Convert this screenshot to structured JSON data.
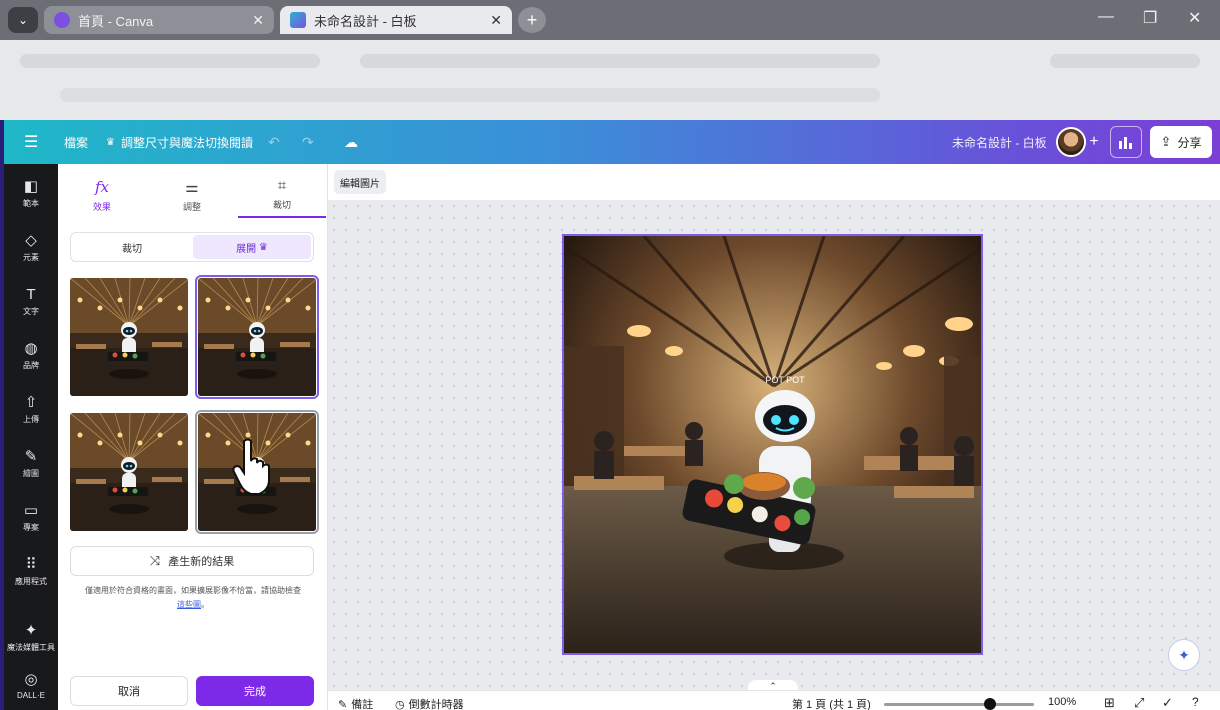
{
  "browser": {
    "tabs": [
      {
        "title": "首頁 - Canva",
        "active": false
      },
      {
        "title": "未命名設計 - 白板",
        "active": true
      }
    ],
    "new_tab": "+",
    "controls": {
      "minimize": "—",
      "restore": "❐",
      "close": "✕"
    }
  },
  "header": {
    "menu_icon": "☰",
    "file_label": "檔案",
    "resize_label": "調整尺寸與魔法切換閱讀",
    "design_title": "未命名設計 - 白板",
    "share_label": "分享",
    "add_people": "+"
  },
  "rail": {
    "items": [
      {
        "label": "範本",
        "icon": "layout-icon",
        "glyph": "◧"
      },
      {
        "label": "元素",
        "icon": "shapes-icon",
        "glyph": "◇"
      },
      {
        "label": "文字",
        "icon": "text-icon",
        "glyph": "T"
      },
      {
        "label": "品牌",
        "icon": "brand-icon",
        "glyph": "◍"
      },
      {
        "label": "上傳",
        "icon": "upload-icon",
        "glyph": "⇧"
      },
      {
        "label": "繪圖",
        "icon": "draw-icon",
        "glyph": "✎"
      },
      {
        "label": "專案",
        "icon": "folder-icon",
        "glyph": "▭"
      },
      {
        "label": "應用程式",
        "icon": "apps-icon",
        "glyph": "⠿"
      },
      {
        "label": "魔法媒體工具",
        "icon": "magic-media-icon",
        "glyph": "✦"
      },
      {
        "label": "DALL·E",
        "icon": "dalle-icon",
        "glyph": "◎"
      }
    ]
  },
  "panel": {
    "tabs": [
      {
        "label": "效果",
        "icon": "fx-icon",
        "glyph": "fx"
      },
      {
        "label": "調整",
        "icon": "sliders-icon",
        "glyph": "⚌"
      },
      {
        "label": "裁切",
        "icon": "crop-icon",
        "glyph": "⌗"
      }
    ],
    "segment": {
      "crop": "裁切",
      "expand": "展開",
      "crown": "♛"
    },
    "generate_label": "產生新的結果",
    "note_text": "僅適用於符合資格的畫面，如果擴展影像不恰當，請協助檢查",
    "note_link": "這些圖",
    "note_tail": "。",
    "cancel_label": "取消",
    "done_label": "完成"
  },
  "canvas": {
    "edit_image_label": "編輯圖片",
    "robot_sign": "POT POT"
  },
  "bottom": {
    "notes_label": "備註",
    "timer_label": "倒數計時器",
    "page_info": "第 1 頁 (共 1 頁)",
    "zoom_percent": "100%",
    "zoom_level": 1.0,
    "collapse_glyph": "⌃"
  },
  "colors": {
    "brand_purple": "#7d2ae8",
    "header_start": "#1fb8c8",
    "header_end": "#7b3fd6"
  }
}
